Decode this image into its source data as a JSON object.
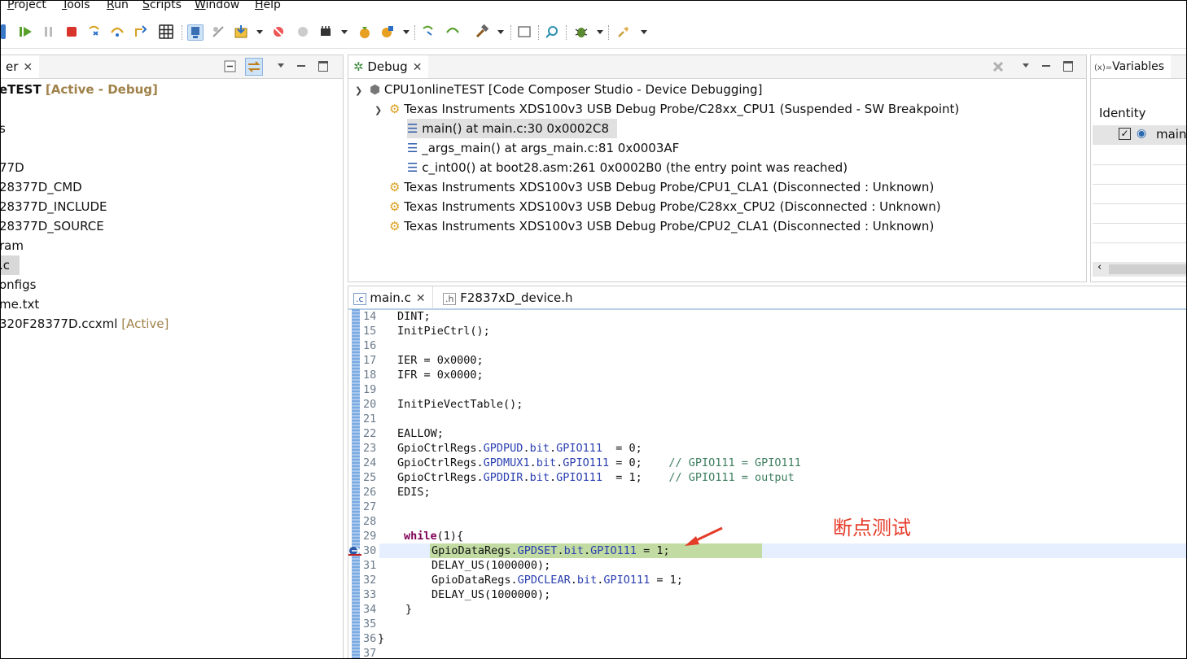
{
  "menu": [
    "Project",
    "Tools",
    "Run",
    "Scripts",
    "Window",
    "Help"
  ],
  "project_explorer": {
    "tab_label": "er",
    "rows": [
      {
        "text": "eTEST",
        "tag": "[Active - Debug]"
      },
      {
        "text": ""
      },
      {
        "text": "s"
      },
      {
        "text": ""
      },
      {
        "text": "77D"
      },
      {
        "text": "28377D_CMD"
      },
      {
        "text": "28377D_INCLUDE"
      },
      {
        "text": "28377D_SOURCE"
      },
      {
        "text": "ram"
      },
      {
        "text": ".c"
      },
      {
        "text": "onfigs"
      },
      {
        "text": "me.txt"
      },
      {
        "text": "320F28377D.ccxml",
        "tag": "[Active]"
      }
    ]
  },
  "debug_view": {
    "tab_label": "Debug",
    "root": "CPU1onlineTEST [Code Composer Studio - Device Debugging]",
    "cpu1": "Texas Instruments XDS100v3 USB Debug Probe/C28xx_CPU1 (Suspended - SW Breakpoint)",
    "frames": [
      "main() at main.c:30 0x0002C8",
      "_args_main() at args_main.c:81 0x0003AF",
      "c_int00() at boot28.asm:261 0x0002B0  (the entry point was reached)"
    ],
    "others": [
      "Texas Instruments XDS100v3 USB Debug Probe/CPU1_CLA1 (Disconnected : Unknown)",
      "Texas Instruments XDS100v3 USB Debug Probe/C28xx_CPU2 (Disconnected : Unknown)",
      "Texas Instruments XDS100v3 USB Debug Probe/CPU2_CLA1 (Disconnected : Unknown)"
    ]
  },
  "variables_view": {
    "tab_label": "Variables",
    "tab_prefix": "(x)=",
    "column_header": "Identity",
    "row_label": "main."
  },
  "editor": {
    "tabs": [
      "main.c",
      "F2837xD_device.h"
    ],
    "line_numbers": [
      "14",
      "15",
      "16",
      "17",
      "18",
      "19",
      "20",
      "21",
      "22",
      "23",
      "24",
      "25",
      "26",
      "27",
      "28",
      "29",
      "30",
      "31",
      "32",
      "33",
      "34",
      "35",
      "36",
      "37"
    ],
    "code": {
      "l14": "DINT;",
      "l15": "InitPieCtrl();",
      "l17": "IER = 0x0000;",
      "l18": "IFR = 0x0000;",
      "l20": "InitPieVectTable();",
      "l22": "EALLOW;",
      "l23_a": "GpioCtrlRegs.",
      "l23_b": "GPDPUD",
      "l23_c": ".",
      "l23_d": "bit",
      "l23_e": ".",
      "l23_f": "GPIO111",
      "l23_g": "  = 0;",
      "l24_a": "GpioCtrlRegs.",
      "l24_b": "GPDMUX1",
      "l24_c": ".",
      "l24_d": "bit",
      "l24_e": ".",
      "l24_f": "GPIO111",
      "l24_g": " = 0;    ",
      "l24_h": "// GPIO111 = GPIO111",
      "l25_a": "GpioCtrlRegs.",
      "l25_b": "GPDDIR",
      "l25_c": ".",
      "l25_d": "bit",
      "l25_e": ".",
      "l25_f": "GPIO111",
      "l25_g": "  = 1;    ",
      "l25_h": "// GPIO111 = output",
      "l26": "EDIS;",
      "l29_a": "while",
      "l29_b": "(1){",
      "l30_a": "GpioDataRegs.",
      "l30_b": "GPDSET",
      "l30_c": ".",
      "l30_d": "bit",
      "l30_e": ".",
      "l30_f": "GPIO111",
      "l30_g": " = 1;",
      "l31": "DELAY_US(1000000);",
      "l32_a": "GpioDataRegs.",
      "l32_b": "GPDCLEAR",
      "l32_c": ".",
      "l32_d": "bit",
      "l32_e": ".",
      "l32_f": "GPIO111",
      "l32_g": " = 1;",
      "l33": "DELAY_US(1000000);",
      "l34": "}",
      "l36": "}"
    }
  },
  "annotation": {
    "text": "断点测试",
    "color": "#e53c2a"
  }
}
